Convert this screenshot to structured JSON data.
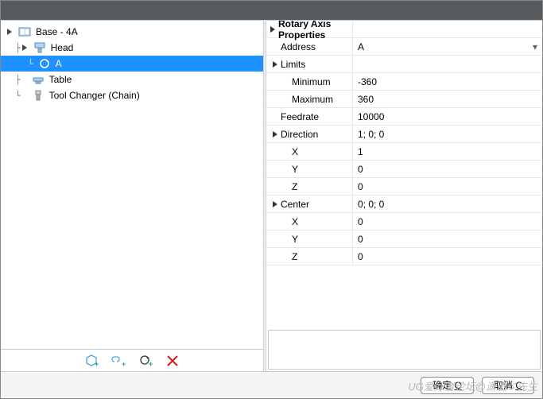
{
  "tree": {
    "root_label": "Base - 4A",
    "head_label": "Head",
    "a_label": "A",
    "table_label": "Table",
    "toolchanger_label": "Tool Changer (Chain)"
  },
  "props": {
    "title": "Rotary Axis Properties",
    "address_label": "Address",
    "address_value": "A",
    "limits_label": "Limits",
    "minimum_label": "Minimum",
    "minimum_value": "-360",
    "maximum_label": "Maximum",
    "maximum_value": "360",
    "feedrate_label": "Feedrate",
    "feedrate_value": "10000",
    "direction_label": "Direction",
    "direction_summary": "1; 0; 0",
    "dx_label": "X",
    "dx_value": "1",
    "dy_label": "Y",
    "dy_value": "0",
    "dz_label": "Z",
    "dz_value": "0",
    "center_label": "Center",
    "center_summary": "0; 0; 0",
    "cx_label": "X",
    "cx_value": "0",
    "cy_label": "Y",
    "cy_value": "0",
    "cz_label": "Z",
    "cz_value": "0"
  },
  "buttons": {
    "ok": "确定",
    "ok_key": "O",
    "cancel": "取消",
    "cancel_key": "C"
  },
  "toolbar_icons": {
    "add": "add-cube-icon",
    "link": "link-icon",
    "rotary": "rotary-add-icon",
    "delete": "delete-icon"
  },
  "watermark": "UG爱好者论坛@潇洒ゞ先生"
}
